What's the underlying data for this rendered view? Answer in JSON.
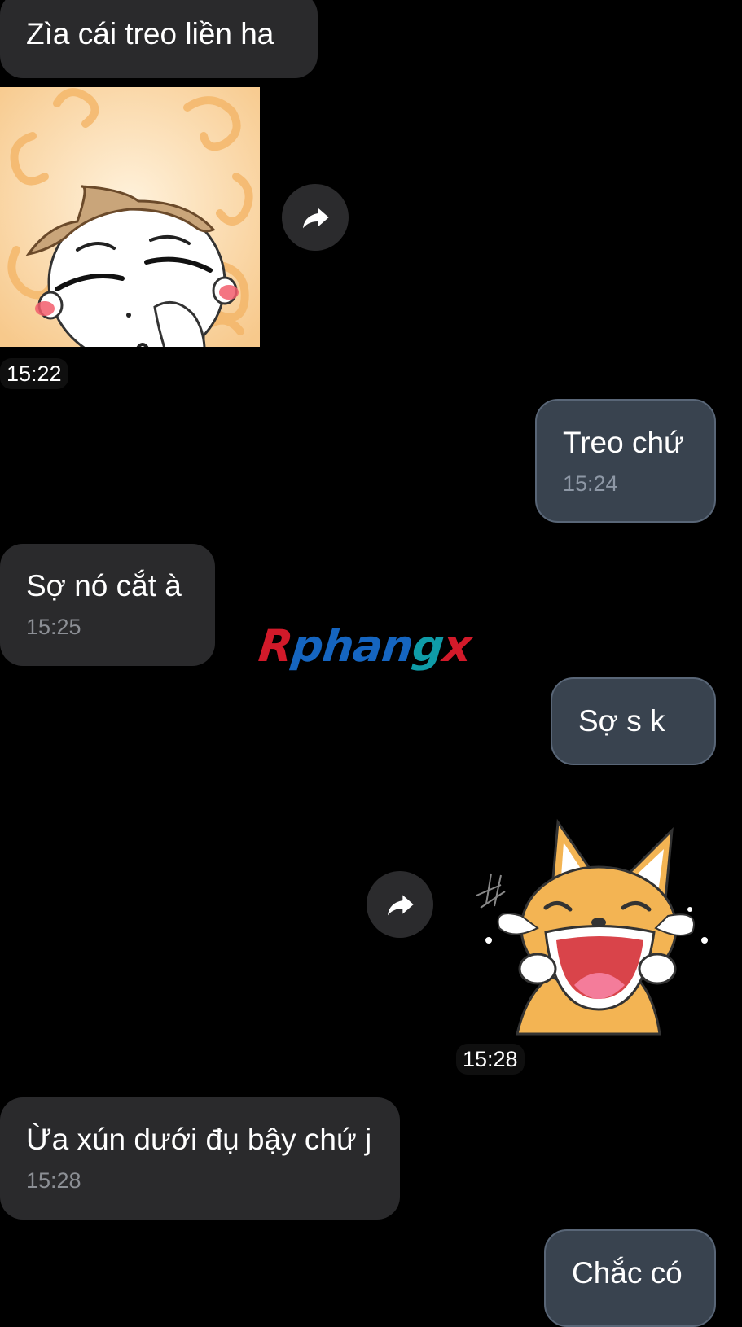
{
  "messages": [
    {
      "id": "m1",
      "side": "in",
      "text": "Zìa cái treo liền ha"
    },
    {
      "id": "m2",
      "side": "in",
      "type": "sticker",
      "sticker": "blushing-boy-sticker",
      "time": "15:22"
    },
    {
      "id": "m3",
      "side": "out",
      "text": "Treo chứ",
      "time": "15:24"
    },
    {
      "id": "m4",
      "side": "in",
      "text": "Sợ nó cắt à",
      "time": "15:25"
    },
    {
      "id": "m5",
      "side": "out",
      "text": "Sợ s k"
    },
    {
      "id": "m6",
      "side": "out",
      "type": "sticker",
      "sticker": "laughing-fox-sticker",
      "time": "15:28"
    },
    {
      "id": "m7",
      "side": "in",
      "text": "Ừa xún dưới đụ bậy chứ j",
      "time": "15:28"
    },
    {
      "id": "m8",
      "side": "out",
      "text": "Chắc có"
    }
  ],
  "watermark": {
    "part1": "R",
    "part2": "phan",
    "part3": "g",
    "part4": "x"
  },
  "icons": {
    "forward": "forward-arrow-icon"
  },
  "colors": {
    "background": "#000000",
    "incoming_bubble": "#2a2a2c",
    "outgoing_bubble": "#39434f",
    "outgoing_border": "#596677",
    "timestamp": "#8c8f95"
  }
}
